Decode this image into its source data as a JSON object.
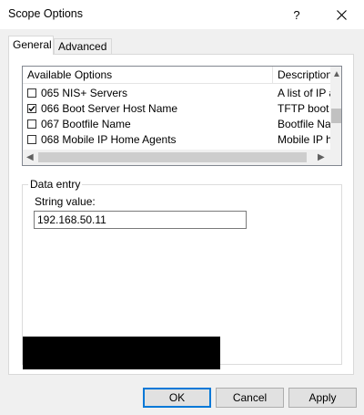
{
  "window": {
    "title": "Scope Options",
    "help_label": "?",
    "accent_color": "#0078d7"
  },
  "tabs": [
    {
      "label": "General",
      "active": true
    },
    {
      "label": "Advanced",
      "active": false
    }
  ],
  "options_list": {
    "columns": [
      "Available Options",
      "Description"
    ],
    "rows": [
      {
        "checked": false,
        "name": "065 NIS+ Servers",
        "description": "A list of IP a"
      },
      {
        "checked": true,
        "name": "066 Boot Server Host Name",
        "description": "TFTP boot s"
      },
      {
        "checked": false,
        "name": "067 Bootfile Name",
        "description": "Bootfile Nan"
      },
      {
        "checked": false,
        "name": "068 Mobile IP Home Agents",
        "description": "Mobile IP ho"
      }
    ],
    "scroll_arrows": {
      "up": "▲",
      "down": "▼",
      "left": "◀",
      "right": "▶"
    }
  },
  "data_entry": {
    "group_label": "Data entry",
    "field_label": "String value:",
    "field_value": "192.168.50.11"
  },
  "buttons": {
    "ok": "OK",
    "cancel": "Cancel",
    "apply": "Apply"
  }
}
